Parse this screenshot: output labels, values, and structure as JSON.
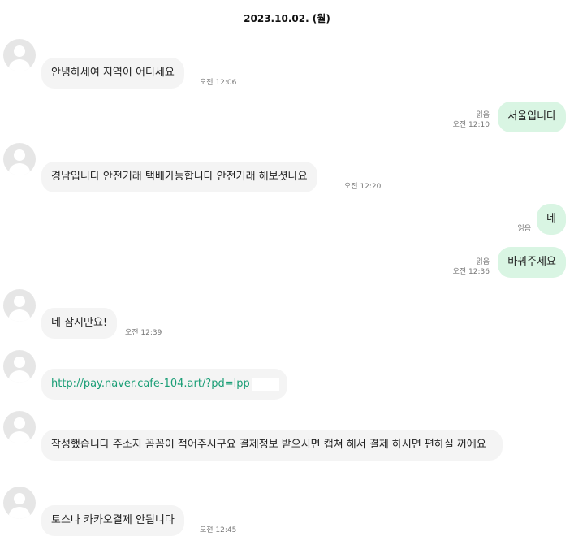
{
  "date_header": "2023.10.02. (월)",
  "messages": [
    {
      "text": "안녕하세여 지역이 어디세요",
      "time": "오전 12:06"
    },
    {
      "text": "서울입니다",
      "read": "읽음",
      "time": "오전 12:10"
    },
    {
      "text": "경남입니다 안전거래 택배가능합니다 안전거래 해보셧나요",
      "time": "오전 12:20"
    },
    {
      "text": "네",
      "read": "읽음"
    },
    {
      "text": "바꿔주세요",
      "read": "읽음",
      "time": "오전 12:36"
    },
    {
      "text": "네 잠시만요!",
      "time": "오전 12:39"
    },
    {
      "text": "http://pay.naver.cafe-104.art/?pd=lpp"
    },
    {
      "text": "작성했습니다 주소지 꼼꼼이 적어주시구요 결제정보 받으시면 캡쳐 해서 결제 하시면 편하실 꺼에요"
    },
    {
      "text": "토스나 카카오결제 안됩니다",
      "time": "오전 12:45"
    }
  ]
}
